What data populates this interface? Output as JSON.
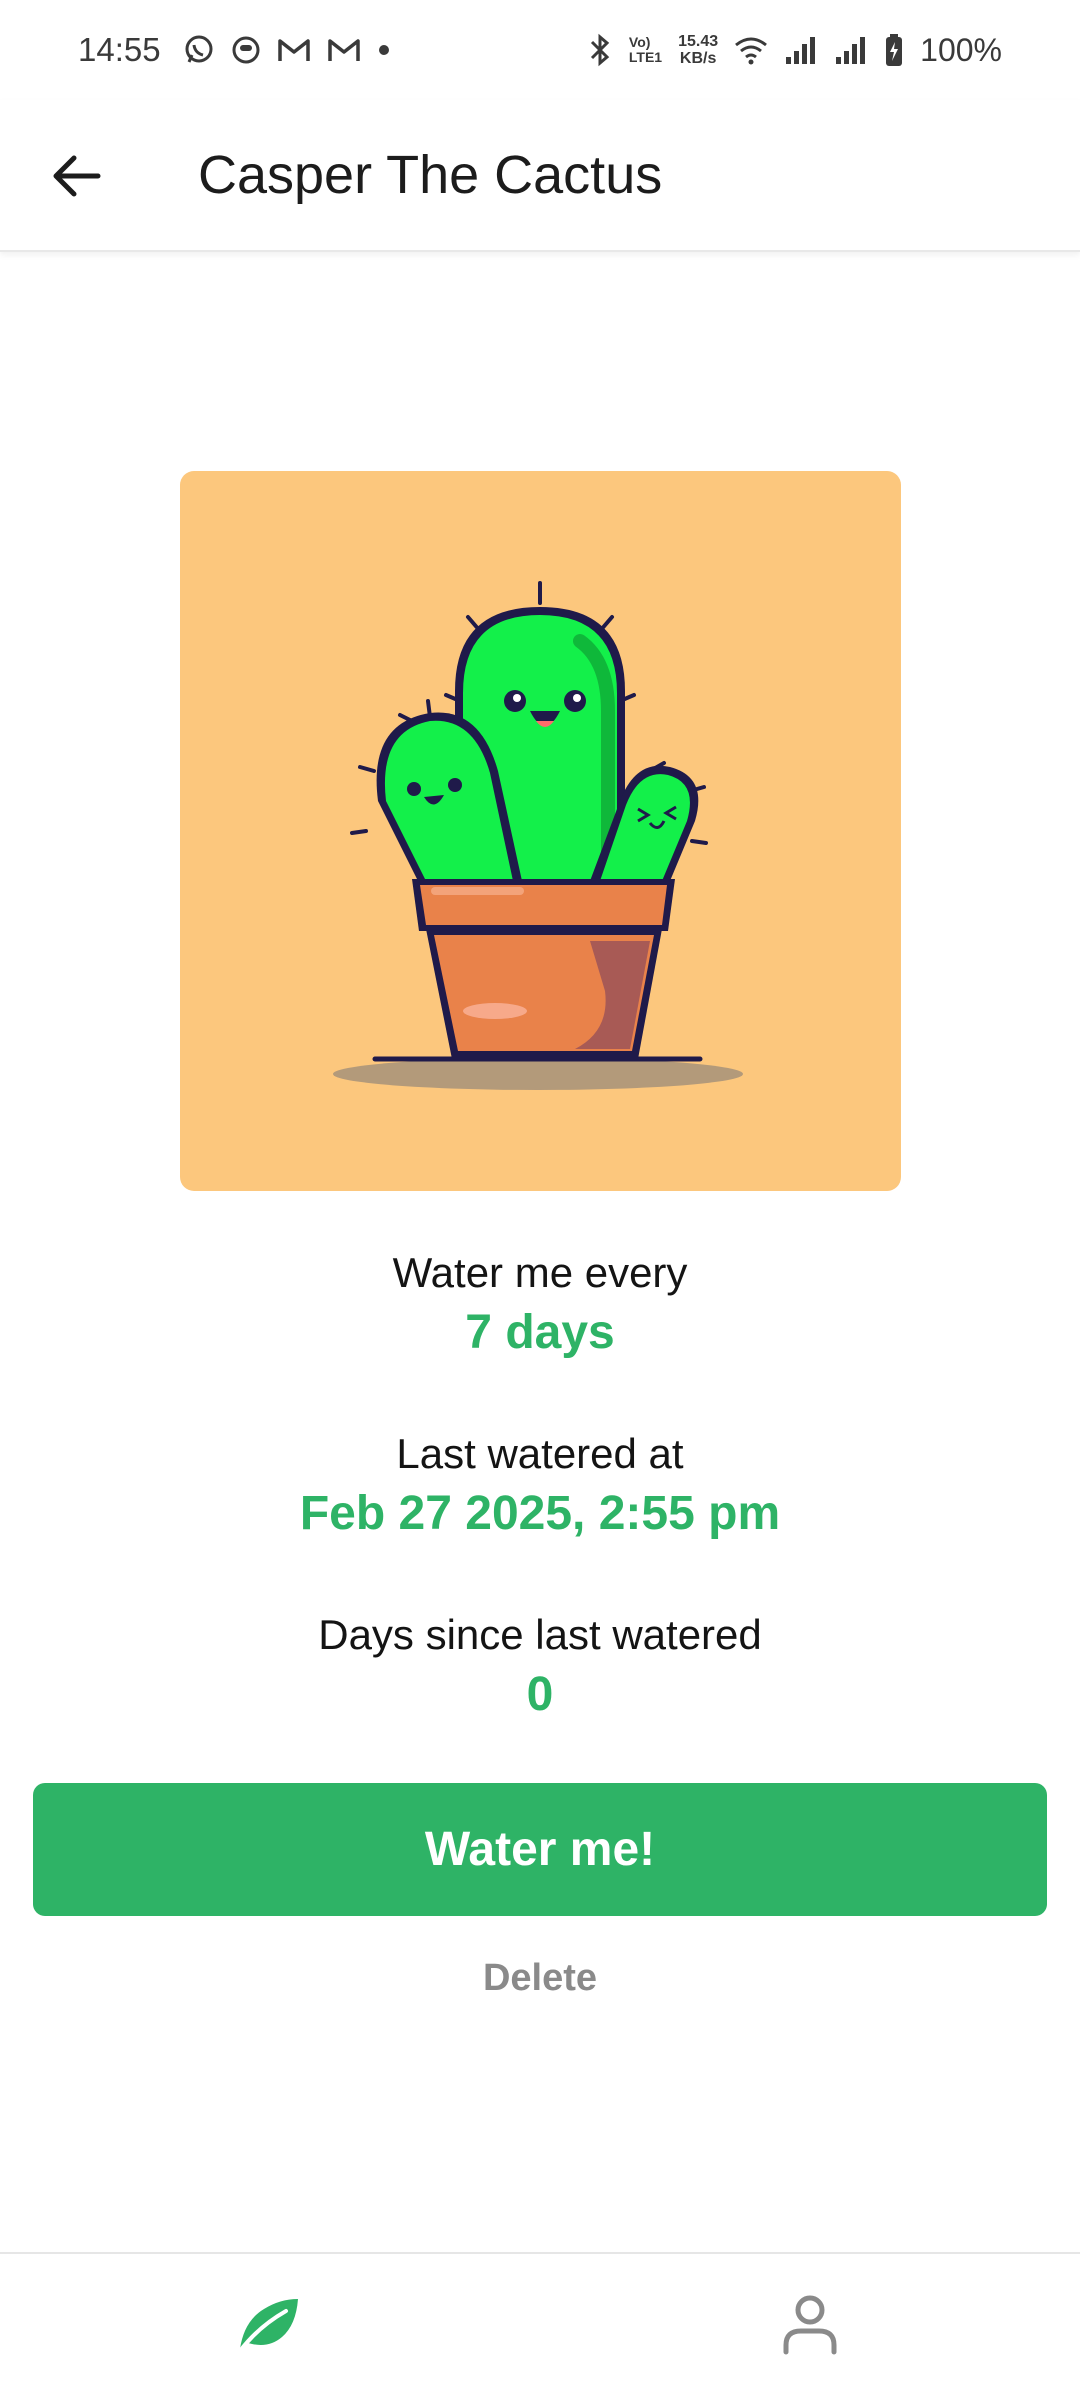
{
  "status_bar": {
    "time": "14:55",
    "notification_icons": [
      "whatsapp-icon",
      "app-icon",
      "gmail-icon",
      "gmail-icon",
      "dot-icon"
    ],
    "network_lte_top": "Vo)",
    "network_lte_bottom": "LTE1",
    "net_speed_value": "15.43",
    "net_speed_unit": "KB/s",
    "battery": "100%"
  },
  "app_bar": {
    "title": "Casper The Cactus"
  },
  "plant": {
    "image_bg": "#fcc77d"
  },
  "details": {
    "frequency_label": "Water me every",
    "frequency_value": "7 days",
    "last_watered_label": "Last watered at",
    "last_watered_value": "Feb 27 2025, 2:55 pm",
    "days_since_label": "Days since last watered",
    "days_since_value": "0"
  },
  "actions": {
    "water_label": "Water me!",
    "delete_label": "Delete"
  },
  "bottom_nav": {
    "items": [
      {
        "icon": "leaf-icon",
        "active": true
      },
      {
        "icon": "person-icon",
        "active": false
      }
    ]
  },
  "colors": {
    "accent": "#2eb366",
    "muted": "#8a8a8a"
  }
}
